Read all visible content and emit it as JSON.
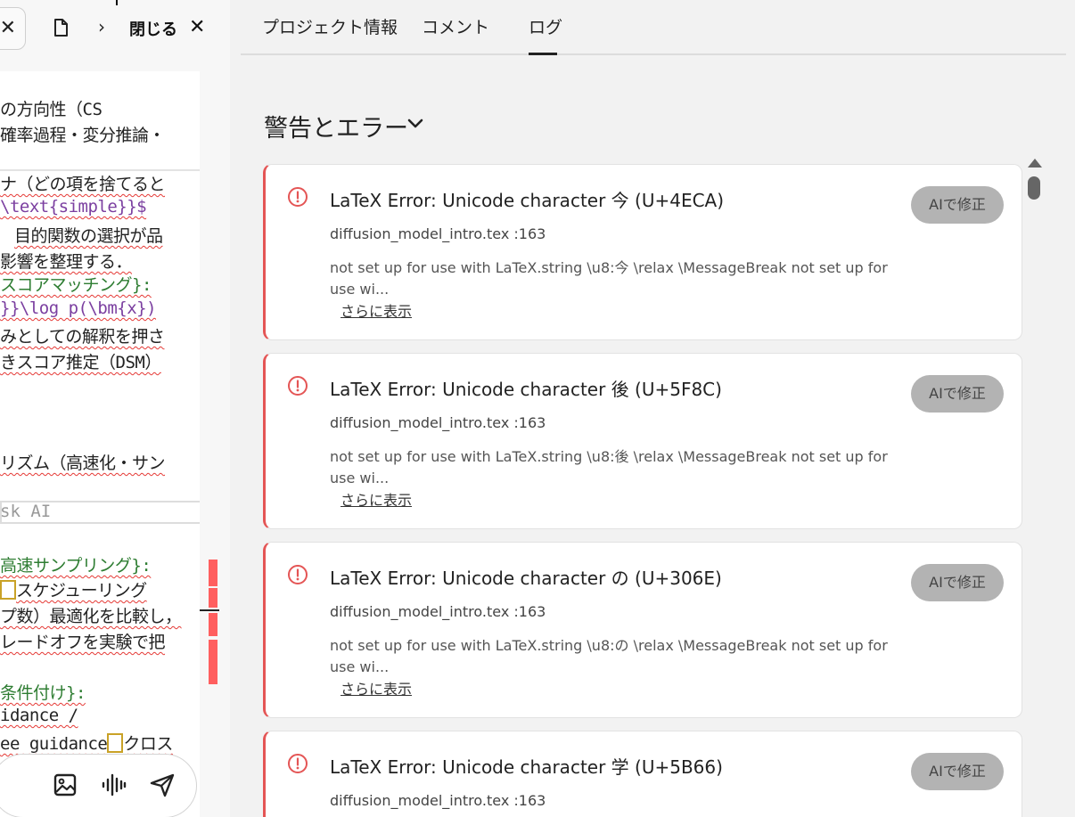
{
  "toolbar": {
    "close_label": "閉じる"
  },
  "editor": {
    "lines": [
      "の方向性（CS",
      "確率過程・変分推論・",
      "ナ（どの項を捨てると",
      "\\text{simple}}$",
      "目的関数の選択が品",
      "影響を整理する．",
      "スコアマッチング}:",
      "}}\\log p(\\bm{x})",
      "みとしての解釈を押さ",
      "きスコア推定（DSM）",
      "リズム（高速化・サン",
      "高速サンプリング}:",
      "スケジューリング",
      "プ数）最適化を比較し，",
      "レードオフを実験で把",
      "条件付け}:",
      "idance /",
      "ee guidance",
      "クロス"
    ],
    "ask_placeholder": "sk AI"
  },
  "tabs": [
    {
      "label": "プロジェクト情報"
    },
    {
      "label": "コメント"
    },
    {
      "label": "ログ"
    }
  ],
  "section": {
    "title": "警告とエラー"
  },
  "errors": [
    {
      "title": "LaTeX Error: Unicode character 今 (U+4ECA)",
      "file": "diffusion_model_intro.tex :163",
      "message": "not set up for use with LaTeX.string \\u8:今 \\relax \\MessageBreak not set up for use wi...",
      "more": "さらに表示",
      "fix": "AIで修正"
    },
    {
      "title": "LaTeX Error: Unicode character 後 (U+5F8C)",
      "file": "diffusion_model_intro.tex :163",
      "message": "not set up for use with LaTeX.string \\u8:後 \\relax \\MessageBreak not set up for use wi...",
      "more": "さらに表示",
      "fix": "AIで修正"
    },
    {
      "title": "LaTeX Error: Unicode character の (U+306E)",
      "file": "diffusion_model_intro.tex :163",
      "message": "not set up for use with LaTeX.string \\u8:の \\relax \\MessageBreak not set up for use wi...",
      "more": "さらに表示",
      "fix": "AIで修正"
    },
    {
      "title": "LaTeX Error: Unicode character 学 (U+5B66)",
      "file": "diffusion_model_intro.tex :163",
      "fix": "AIで修正"
    }
  ],
  "colors": {
    "error_accent": "#e45555",
    "fix_button_bg": "#b3b3b3",
    "spell_underline": "#e53935"
  }
}
